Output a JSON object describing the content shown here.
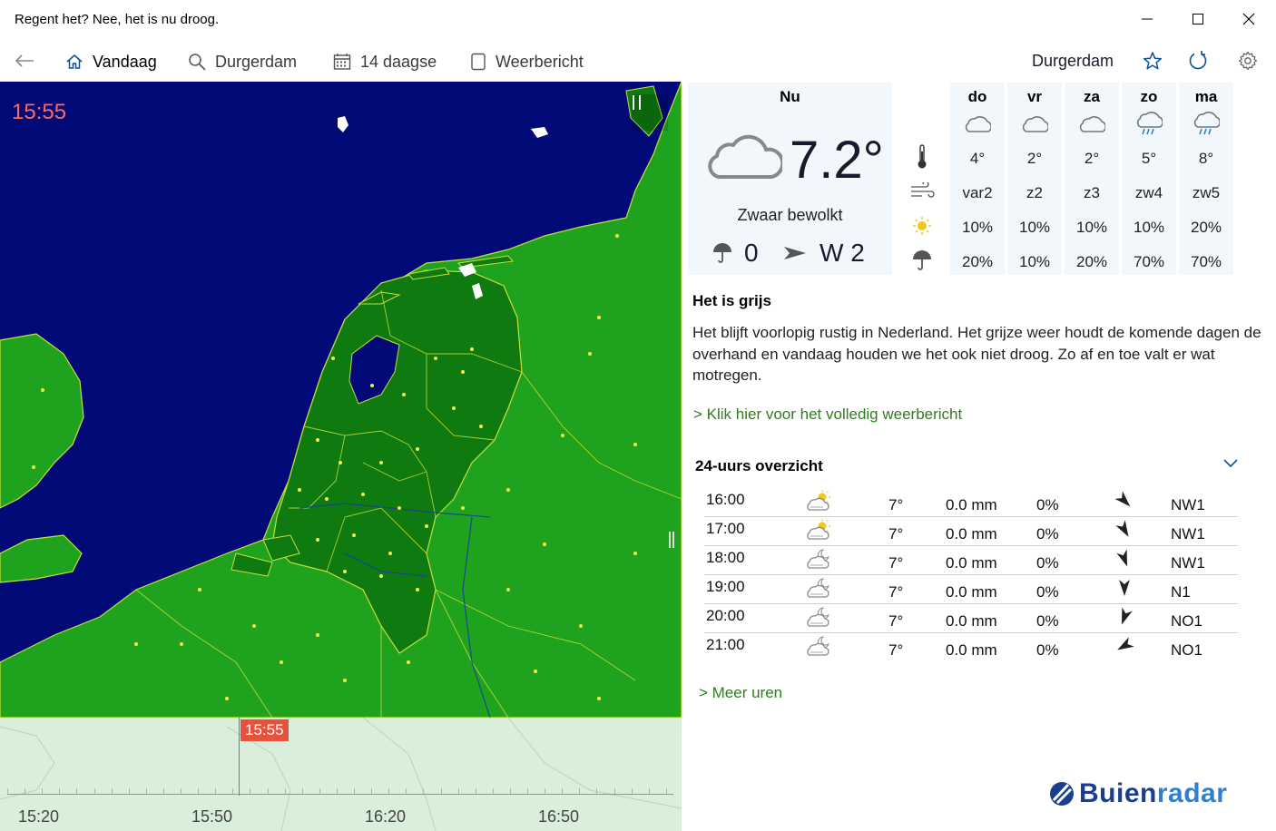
{
  "window": {
    "title": "Regent het? Nee, het is nu droog."
  },
  "nav": {
    "tabs": [
      {
        "label": "Vandaag",
        "icon": "home-icon",
        "active": true
      },
      {
        "label": "Durgerdam",
        "icon": "search-icon",
        "active": false
      },
      {
        "label": "14 daagse",
        "icon": "calendar-icon",
        "active": false
      },
      {
        "label": "Weerbericht",
        "icon": "document-icon",
        "active": false
      }
    ],
    "location": "Durgerdam"
  },
  "map": {
    "time": "15:55",
    "colors": {
      "sea": "#020a78",
      "land": "#1fa31f",
      "netherlands": "#0e7a10",
      "borders": "#c9de3a",
      "time_text": "#ff6a5a"
    }
  },
  "timeline": {
    "current": "15:55",
    "labels": [
      "15:20",
      "15:50",
      "16:20",
      "16:50"
    ],
    "marker_color": "#e5533f"
  },
  "now": {
    "title": "Nu",
    "temperature": "7.2°",
    "description": "Zwaar bewolkt",
    "rain": "0",
    "wind": "W 2",
    "icon": "cloud-icon"
  },
  "row_icons": [
    "thermometer-icon",
    "wind-icon",
    "sun-icon",
    "umbrella-icon"
  ],
  "days": [
    {
      "name": "do",
      "icon": "cloud-icon",
      "temp": "4°",
      "wind": "var2",
      "sun": "10%",
      "rain": "20%"
    },
    {
      "name": "vr",
      "icon": "cloud-icon",
      "temp": "2°",
      "wind": "z2",
      "sun": "10%",
      "rain": "10%"
    },
    {
      "name": "za",
      "icon": "cloud-icon",
      "temp": "2°",
      "wind": "z3",
      "sun": "10%",
      "rain": "20%"
    },
    {
      "name": "zo",
      "icon": "rain-cloud-icon",
      "temp": "5°",
      "wind": "zw4",
      "sun": "10%",
      "rain": "70%"
    },
    {
      "name": "ma",
      "icon": "rain-cloud-icon",
      "temp": "8°",
      "wind": "zw5",
      "sun": "20%",
      "rain": "70%"
    }
  ],
  "forecast": {
    "title": "Het is grijs",
    "body": "Het blijft voorlopig rustig in Nederland. Het grijze weer houdt de komende dagen de overhand en vandaag houden we het ook niet droog. Zo af en toe valt er wat motregen.",
    "link": "> Klik hier voor het volledig weerbericht"
  },
  "overview": {
    "title": "24-uurs overzicht",
    "rows": [
      {
        "time": "16:00",
        "icon": "sun-cloud-icon",
        "temp": "7°",
        "mm": "0.0 mm",
        "pct": "0%",
        "dir": "NW1",
        "angle": 135
      },
      {
        "time": "17:00",
        "icon": "sun-cloud-icon",
        "temp": "7°",
        "mm": "0.0 mm",
        "pct": "0%",
        "dir": "NW1",
        "angle": 150
      },
      {
        "time": "18:00",
        "icon": "moon-cloud-icon",
        "temp": "7°",
        "mm": "0.0 mm",
        "pct": "0%",
        "dir": "NW1",
        "angle": 160
      },
      {
        "time": "19:00",
        "icon": "moon-cloud-icon",
        "temp": "7°",
        "mm": "0.0 mm",
        "pct": "0%",
        "dir": "N1",
        "angle": 180
      },
      {
        "time": "20:00",
        "icon": "moon-cloud-icon",
        "temp": "7°",
        "mm": "0.0 mm",
        "pct": "0%",
        "dir": "NO1",
        "angle": 200
      },
      {
        "time": "21:00",
        "icon": "moon-cloud-icon",
        "temp": "7°",
        "mm": "0.0 mm",
        "pct": "0%",
        "dir": "NO1",
        "angle": 240
      }
    ],
    "more": "> Meer uren"
  },
  "logo": {
    "part1": "Buien",
    "part2": "radar"
  }
}
